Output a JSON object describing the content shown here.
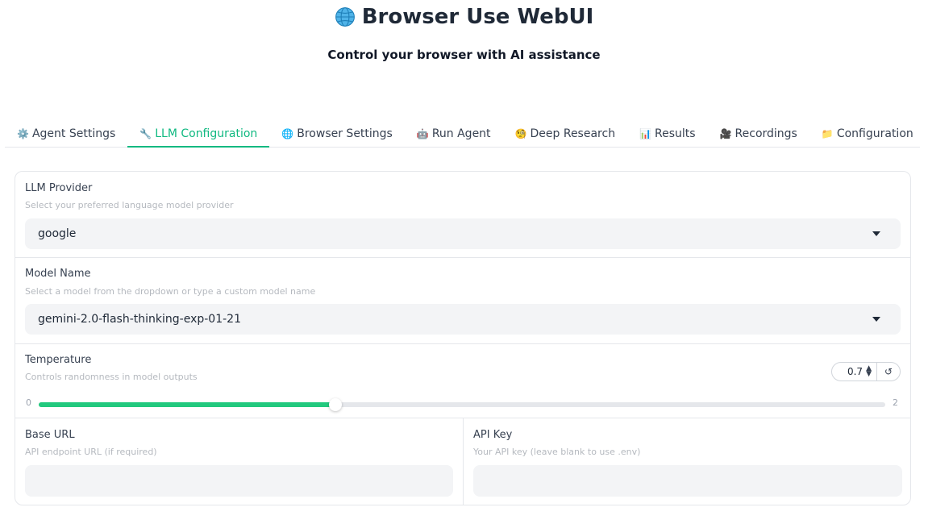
{
  "app": {
    "title": "Browser Use WebUI",
    "subtitle": "Control your browser with AI assistance"
  },
  "tabs": [
    {
      "icon": "⚙️",
      "label": "Agent Settings",
      "active": false
    },
    {
      "icon": "🔧",
      "label": "LLM Configuration",
      "active": true
    },
    {
      "icon": "🌐",
      "label": "Browser Settings",
      "active": false
    },
    {
      "icon": "🤖",
      "label": "Run Agent",
      "active": false
    },
    {
      "icon": "🧐",
      "label": "Deep Research",
      "active": false
    },
    {
      "icon": "📊",
      "label": "Results",
      "active": false
    },
    {
      "icon": "🎥",
      "label": "Recordings",
      "active": false
    },
    {
      "icon": "📁",
      "label": "Configuration",
      "active": false
    }
  ],
  "llm": {
    "provider": {
      "label": "LLM Provider",
      "info": "Select your preferred language model provider",
      "value": "google"
    },
    "model": {
      "label": "Model Name",
      "info": "Select a model from the dropdown or type a custom model name",
      "value": "gemini-2.0-flash-thinking-exp-01-21"
    },
    "temperature": {
      "label": "Temperature",
      "info": "Controls randomness in model outputs",
      "value": "0.7",
      "min": "0",
      "max": "2",
      "fraction": 0.35
    },
    "base_url": {
      "label": "Base URL",
      "info": "API endpoint URL (if required)",
      "value": ""
    },
    "api_key": {
      "label": "API Key",
      "info": "Your API key (leave blank to use .env)",
      "value": ""
    }
  },
  "colors": {
    "accent": "#10b981",
    "slider_fill": "#22c97e"
  }
}
